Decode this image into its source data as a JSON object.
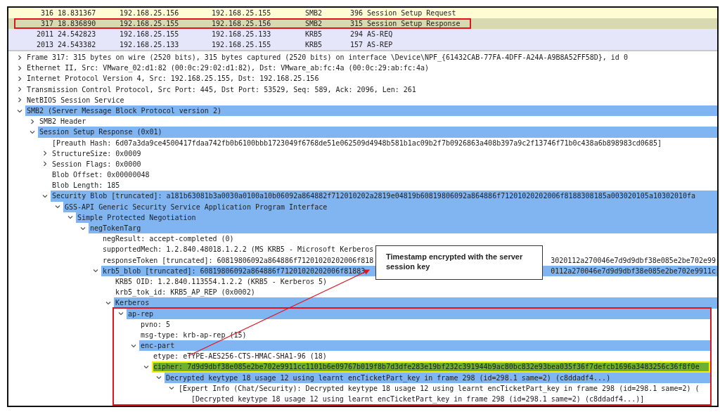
{
  "packet_list": {
    "rows": [
      {
        "no": "316",
        "time": "18.831367",
        "source": "192.168.25.156",
        "destination": "192.168.25.155",
        "protocol": "SMB2",
        "length": "396",
        "info": "Session Setup Request",
        "color": "#fdfcd3",
        "boxed": false
      },
      {
        "no": "317",
        "time": "18.836890",
        "source": "192.168.25.155",
        "destination": "192.168.25.156",
        "protocol": "SMB2",
        "length": "315",
        "info": "Session Setup Response",
        "color": "#d8d8b1",
        "boxed": true
      },
      {
        "no": "2011",
        "time": "24.542823",
        "source": "192.168.25.155",
        "destination": "192.168.25.133",
        "protocol": "KRB5",
        "length": "294",
        "info": "AS-REQ",
        "color": "#e6e6fa",
        "boxed": false
      },
      {
        "no": "2013",
        "time": "24.543382",
        "source": "192.168.25.133",
        "destination": "192.168.25.155",
        "protocol": "KRB5",
        "length": "157",
        "info": "AS-REP",
        "color": "#e6e6fa",
        "boxed": false
      }
    ]
  },
  "details": {
    "tree": [
      {
        "text": "Frame 317: 315 bytes on wire (2520 bits), 315 bytes captured (2520 bits) on interface \\Device\\NPF_{61432CAB-77FA-4DFF-A24A-A9B8A52FF58D}, id 0",
        "expanded": false
      },
      {
        "text": "Ethernet II, Src: VMware_02:d1:82 (00:0c:29:02:d1:82), Dst: VMware_ab:fc:4a (00:0c:29:ab:fc:4a)",
        "expanded": false
      },
      {
        "text": "Internet Protocol Version 4, Src: 192.168.25.155, Dst: 192.168.25.156",
        "expanded": false
      },
      {
        "text": "Transmission Control Protocol, Src Port: 445, Dst Port: 53529, Seq: 589, Ack: 2096, Len: 261",
        "expanded": false
      },
      {
        "text": "NetBIOS Session Service",
        "expanded": false
      },
      {
        "text": "SMB2 (Server Message Block Protocol version 2)",
        "expanded": true,
        "color": "#80b5f2",
        "children": [
          {
            "text": "SMB2 Header",
            "expanded": false
          },
          {
            "text": "Session Setup Response (0x01)",
            "expanded": true,
            "color": "#80b5f2",
            "children": [
              {
                "text": "[Preauth Hash: 6d07a3da9ce4500417fdaa742fb0b6100bbb1723049f6768de51e062509d4948b581b1ac09b2f7b0926863a408b397a9c2f13746f71b0c438a6b898983cd0685]"
              },
              {
                "text": "StructureSize: 0x0009",
                "expanded": false
              },
              {
                "text": "Session Flags: 0x0000",
                "expanded": false
              },
              {
                "text": "Blob Offset: 0x00000048"
              },
              {
                "text": "Blob Length: 185"
              },
              {
                "text": "Security Blob [truncated]: a181b63081b3a0030a0100a10b06092a864882f712010202a2819e04819b60819806092a864886f71201020202006f8188308185a003020105a10302010fa",
                "expanded": true,
                "color": "#80b5f2",
                "children": [
                  {
                    "text": "GSS-API Generic Security Service Application Program Interface",
                    "expanded": true,
                    "color": "#80b5f2",
                    "children": [
                      {
                        "text": "Simple Protected Negotiation",
                        "expanded": true,
                        "color": "#80b5f2",
                        "children": [
                          {
                            "text": "negTokenTarg",
                            "expanded": true,
                            "color": "#80b5f2",
                            "children": [
                              {
                                "text": "negResult: accept-completed (0)"
                              },
                              {
                                "text": "supportedMech: 1.2.840.48018.1.2.2 (MS KRB5 - Microsoft Kerberos"
                              },
                              {
                                "text": "responseToken [truncated]: 60819806092a864886f71201020202006f818",
                                "text_after": "3020112a270046e7d9d9dbf38e085e2be702e99"
                              },
                              {
                                "text": "krb5_blob [truncated]: 60819806092a864886f71201020202006f81883",
                                "text_after": "0112a270046e7d9d9dbf38e085e2be702e9911c",
                                "expanded": true,
                                "color": "#80b5f2",
                                "children": [
                                  {
                                    "text": "KRB5 OID: 1.2.840.113554.1.2.2 (KRB5 - Kerberos 5)"
                                  },
                                  {
                                    "text": "krb5_tok_id: KRB5_AP_REP (0x0002)"
                                  },
                                  {
                                    "text": "Kerberos",
                                    "expanded": true,
                                    "color": "#80b5f2",
                                    "children": [
                                      {
                                        "text": "ap-rep",
                                        "expanded": true,
                                        "color": "#80b5f2",
                                        "boxed": true,
                                        "children": [
                                          {
                                            "text": "pvno: 5"
                                          },
                                          {
                                            "text": "msg-type: krb-ap-rep (15)"
                                          },
                                          {
                                            "text": "enc-part",
                                            "expanded": true,
                                            "color": "#80b5f2",
                                            "children": [
                                              {
                                                "text": "etype: eTYPE-AES256-CTS-HMAC-SHA1-96 (18)"
                                              },
                                              {
                                                "text": "cipher: 7d9d9dbf38e085e2be702e9911cc1101b6e09767b019f8b7d3dfe283e19bf232c391944b9ac80bc832e93bea035f36f7defcb1696a3483256c36f8f0e",
                                                "expanded": true,
                                                "color": "#6fae2e",
                                                "focused": true,
                                                "children": [
                                                  {
                                                    "text": "Decrypted keytype 18 usage 12 using learnt encTicketPart_key in frame 298 (id=298.1 same=2) (c8ddadf4...)",
                                                    "expanded": true,
                                                    "color": "#80b5f2",
                                                    "children": [
                                                      {
                                                        "text": "[Expert Info (Chat/Security): Decrypted keytype 18 usage 12 using learnt encTicketPart_key in frame 298 (id=298.1 same=2) (",
                                                        "expanded": true,
                                                        "children": [
                                                          {
                                                            "text": "[Decrypted keytype 18 usage 12 using learnt encTicketPart_key in frame 298 (id=298.1 same=2) (c8ddadf4...)]"
                                                          }
                                                        ]
                                                      }
                                                    ]
                                                  }
                                                ]
                                              }
                                            ]
                                          }
                                        ]
                                      }
                                    ]
                                  }
                                ]
                              }
                            ]
                          }
                        ]
                      }
                    ]
                  }
                ]
              }
            ]
          }
        ]
      }
    ]
  },
  "callout": {
    "text": "Timestamp encrypted with the server session key"
  }
}
